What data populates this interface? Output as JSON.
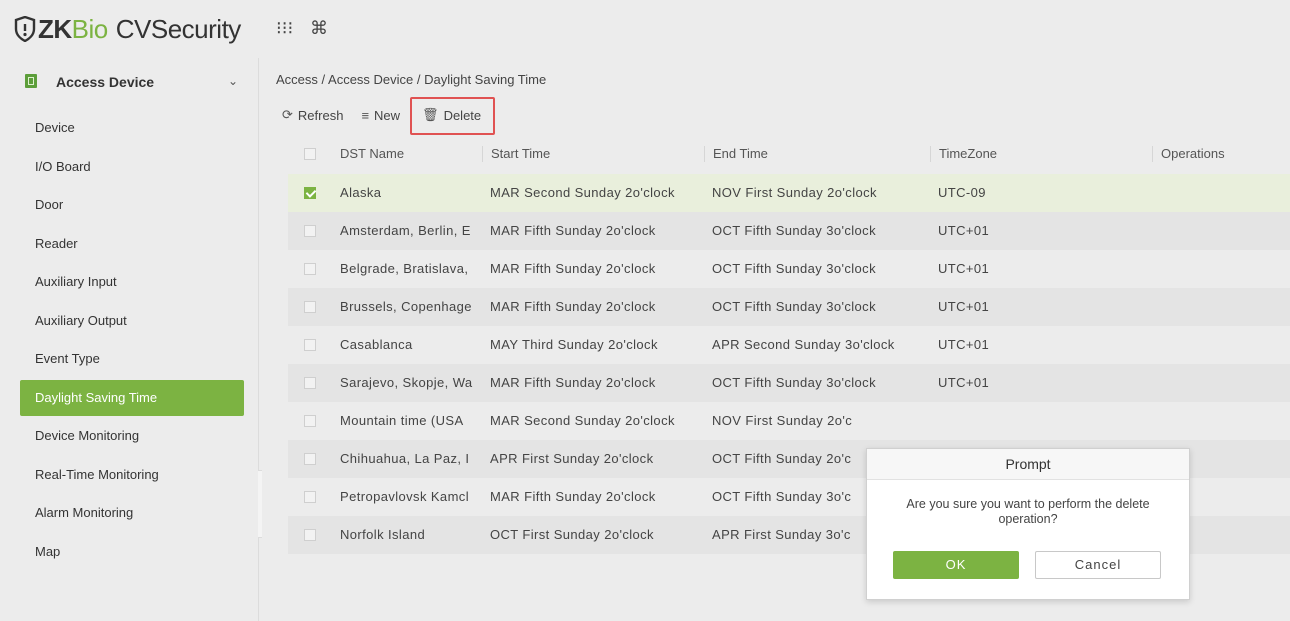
{
  "app": {
    "logo_zk": "ZK",
    "logo_bio": "Bio",
    "logo_cv": "CVSecurity",
    "icons": [
      "grid-icon",
      "command-icon"
    ]
  },
  "sidebar": {
    "module_title": "Access Device",
    "items": [
      {
        "label": "Device"
      },
      {
        "label": "I/O Board"
      },
      {
        "label": "Door"
      },
      {
        "label": "Reader"
      },
      {
        "label": "Auxiliary Input"
      },
      {
        "label": "Auxiliary Output"
      },
      {
        "label": "Event Type"
      },
      {
        "label": "Daylight Saving Time",
        "active": true
      },
      {
        "label": "Device Monitoring"
      },
      {
        "label": "Real-Time Monitoring"
      },
      {
        "label": "Alarm Monitoring"
      },
      {
        "label": "Map"
      }
    ],
    "collapse_glyph": "«"
  },
  "breadcrumb": "Access / Access Device / Daylight Saving Time",
  "toolbar": {
    "refresh_label": "Refresh",
    "new_label": "New",
    "delete_label": "Delete"
  },
  "table": {
    "columns": [
      "DST Name",
      "Start Time",
      "End Time",
      "TimeZone",
      "Operations"
    ],
    "rows": [
      {
        "name": "Alaska",
        "start": "MAR Second Sunday 2o'clock",
        "end": "NOV First Sunday 2o'clock",
        "tz": "UTC-09",
        "checked": true
      },
      {
        "name": "Amsterdam, Berlin, E",
        "start": "MAR Fifth Sunday 2o'clock",
        "end": "OCT Fifth Sunday 3o'clock",
        "tz": "UTC+01",
        "checked": false
      },
      {
        "name": "Belgrade, Bratislava,",
        "start": "MAR Fifth Sunday 2o'clock",
        "end": "OCT Fifth Sunday 3o'clock",
        "tz": "UTC+01",
        "checked": false
      },
      {
        "name": "Brussels, Copenhage",
        "start": "MAR Fifth Sunday 2o'clock",
        "end": "OCT Fifth Sunday 3o'clock",
        "tz": "UTC+01",
        "checked": false
      },
      {
        "name": "Casablanca",
        "start": "MAY Third Sunday 2o'clock",
        "end": "APR Second Sunday 3o'clock",
        "tz": "UTC+01",
        "checked": false
      },
      {
        "name": "Sarajevo, Skopje, Wa",
        "start": "MAR Fifth Sunday 2o'clock",
        "end": "OCT Fifth Sunday 3o'clock",
        "tz": "UTC+01",
        "checked": false
      },
      {
        "name": "Mountain time (USA",
        "start": "MAR Second Sunday 2o'clock",
        "end": "NOV First Sunday 2o'c",
        "tz": "",
        "checked": false
      },
      {
        "name": "Chihuahua, La Paz, I",
        "start": "APR First Sunday 2o'clock",
        "end": "OCT Fifth Sunday 2o'c",
        "tz": "",
        "checked": false
      },
      {
        "name": "Petropavlovsk Kamcl",
        "start": "MAR Fifth Sunday 2o'clock",
        "end": "OCT Fifth Sunday 3o'c",
        "tz": "",
        "checked": false
      },
      {
        "name": "Norfolk Island",
        "start": "OCT First Sunday 2o'clock",
        "end": "APR First Sunday 3o'c",
        "tz": "",
        "checked": false
      }
    ]
  },
  "dialog": {
    "title": "Prompt",
    "message": "Are you sure you want to perform the delete operation?",
    "ok_label": "OK",
    "cancel_label": "Cancel"
  },
  "colors": {
    "brand_green": "#7cb342",
    "highlight_red": "#e05252",
    "selected_row": "#e9efdc"
  }
}
